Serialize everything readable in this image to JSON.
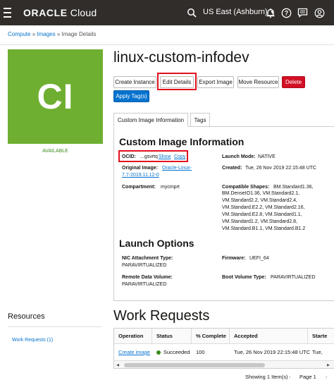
{
  "topbar": {
    "brand_oracle": "ORACLE",
    "brand_cloud": " Cloud",
    "region": "US East (Ashburn)",
    "icons": [
      "menu-icon",
      "search-icon",
      "bell-icon",
      "help-icon",
      "chat-icon",
      "profile-icon"
    ]
  },
  "breadcrumb": {
    "items": [
      "Compute",
      "Images",
      "Image Details"
    ],
    "sep": " » "
  },
  "image": {
    "initials": "CI",
    "status": "AVAILABLE",
    "status_color": "#3c8a1e",
    "avatar_color": "#6eaf31",
    "name": "linux-custom-infodev"
  },
  "actions": {
    "create_instance": "Create Instance",
    "edit_details": "Edit Details",
    "export_image": "Export Image",
    "move_resource": "Move Resource",
    "delete": "Delete",
    "apply_tags": "Apply Tag(s)"
  },
  "tabs": {
    "info": "Custom Image Information",
    "tags": "Tags"
  },
  "info": {
    "heading": "Custom Image Information",
    "ocid_label": "OCID:",
    "ocid_value": "...gsvrtq",
    "ocid_show": "Show",
    "ocid_copy": "Copy",
    "original_image_label": "Original Image:",
    "original_image_line1": "Oracle-Linux-",
    "original_image_line2": "7.7-2019.11.12-0",
    "compartment_label": "Compartment:",
    "compartment_value": "mycmprt",
    "launch_mode_label": "Launch Mode:",
    "launch_mode_value": "NATIVE",
    "created_label": "Created:",
    "created_value": "Tue, 26 Nov 2019 22:15:48 UTC",
    "shapes_label": "Compatible Shapes:",
    "shapes_lines": [
      "BM.Standard1.36,",
      "BM.DenseIO1.36, VM.Standard2.1,",
      "VM.Standard2.2, VM.Standard2.4,",
      "VM.Standard.E2.2, VM.Standard2.16,",
      "VM.Standard.E2.8, VM.Standard1.1,",
      "VM.Standard1.2, VM.Standard2.8,",
      "VM.Standard.B1.1, VM.Standard.B1.2"
    ]
  },
  "launch": {
    "heading": "Launch Options",
    "nic_label": "NIC Attachment Type:",
    "nic_value": "PARAVIRTUALIZED",
    "firmware_label": "Firmware:",
    "firmware_value": "UEFI_64",
    "remote_label": "Remote Data Volume:",
    "remote_value": "PARAVIRTUALIZED",
    "boot_label": "Boot Volume Type:",
    "boot_value": "PARAVIRTUALIZED"
  },
  "resources": {
    "title": "Resources",
    "work_requests_link": "Work Requests (1)"
  },
  "work_requests": {
    "title": "Work Requests",
    "columns": [
      "Operation",
      "Status",
      "% Complete",
      "Accepted",
      "Starte"
    ],
    "rows": [
      {
        "operation": "Create image",
        "status": "Succeeded",
        "percent": "100",
        "accepted": "Tue, 26 Nov 2019 22:15:48 UTC",
        "started": "Tue,"
      }
    ],
    "showing": "Showing 1 Item(s)",
    "page": "Page 1"
  }
}
